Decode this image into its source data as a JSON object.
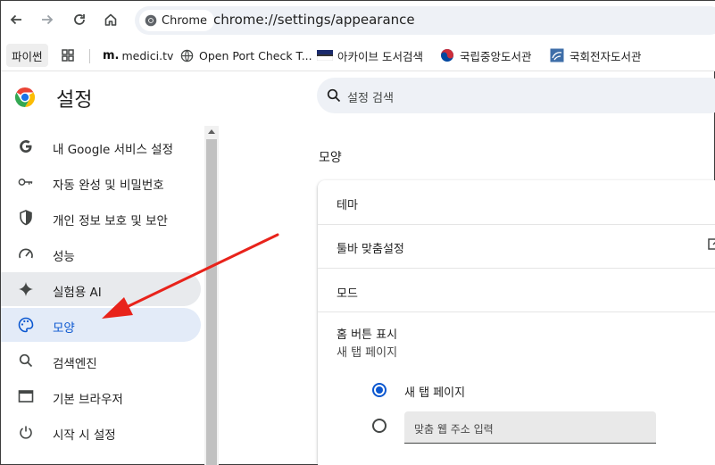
{
  "toolbar": {
    "back_icon": "arrow-left-icon",
    "forward_icon": "arrow-right-icon",
    "reload_icon": "reload-icon",
    "home_icon": "home-icon",
    "chip_label": "Chrome",
    "url": "chrome://settings/appearance"
  },
  "bookmarks": {
    "items": [
      {
        "label": "파이썬",
        "icon": ""
      },
      {
        "label": "",
        "icon": "apps-grid-icon"
      },
      {
        "label": "medici.tv",
        "icon": "medici-logo-icon"
      },
      {
        "label": "Open Port Check T...",
        "icon": "globe-icon"
      },
      {
        "label": "아카이브 도서검색",
        "icon": "archive-flag-icon"
      },
      {
        "label": "국립중앙도서관",
        "icon": "national-library-icon"
      },
      {
        "label": "국회전자도서관",
        "icon": "assembly-library-icon"
      }
    ]
  },
  "settings": {
    "title": "설정",
    "search_placeholder": "설정 검색"
  },
  "sidebar": {
    "items": [
      {
        "label": "내 Google 서비스 설정",
        "icon": "google-g-icon",
        "state": ""
      },
      {
        "label": "자동 완성 및 비밀번호",
        "icon": "key-icon",
        "state": ""
      },
      {
        "label": "개인 정보 보호 및 보안",
        "icon": "shield-icon",
        "state": ""
      },
      {
        "label": "성능",
        "icon": "speedometer-icon",
        "state": ""
      },
      {
        "label": "실험용 AI",
        "icon": "sparkle-icon",
        "state": "hover"
      },
      {
        "label": "모양",
        "icon": "palette-icon",
        "state": "selected"
      },
      {
        "label": "검색엔진",
        "icon": "search-icon",
        "state": ""
      },
      {
        "label": "기본 브라우저",
        "icon": "browser-window-icon",
        "state": ""
      },
      {
        "label": "시작 시 설정",
        "icon": "power-icon",
        "state": ""
      }
    ]
  },
  "main": {
    "section_title": "모양",
    "rows": {
      "theme": "테마",
      "toolbar_customize": "툴바 맞춤설정",
      "mode": "모드",
      "home_button": "홈 버튼 표시",
      "home_button_sub": "새 탭 페이지"
    },
    "radio_options": [
      {
        "label": "새 탭 페이지",
        "checked": true
      },
      {
        "label": "",
        "checked": false
      }
    ],
    "custom_url_placeholder": "맞춤 웹 주소 입력"
  },
  "colors": {
    "accent": "#0b57d0",
    "selected_bg": "#e3ebf8",
    "annotation_arrow": "#e8231b"
  }
}
